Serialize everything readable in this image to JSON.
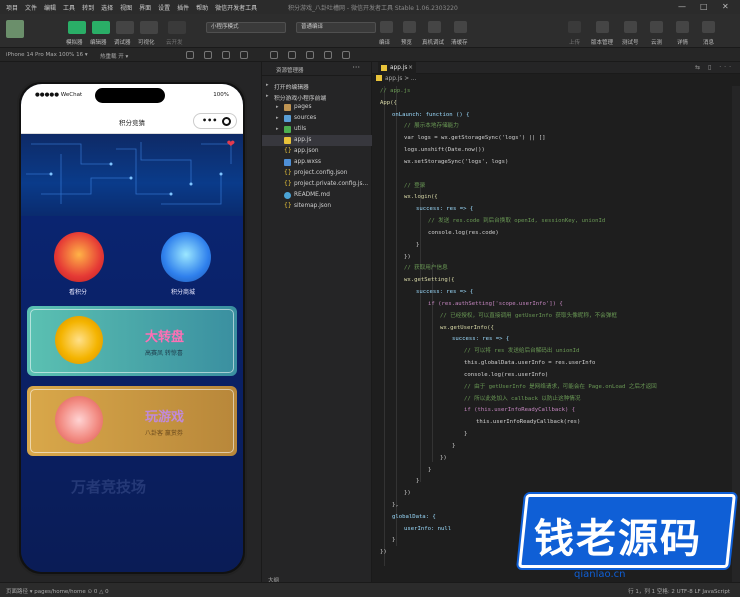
{
  "menu": {
    "items": [
      "项目",
      "文件",
      "编辑",
      "工具",
      "转到",
      "选择",
      "视图",
      "界面",
      "设置",
      "插件",
      "帮助",
      "微信开发者工具"
    ],
    "title": "积分游戏_八卦吐槽网 - 微信开发者工具 Stable 1.06.2303220"
  },
  "toolbar": {
    "buttons": [
      "模拟器",
      "编辑器",
      "调试器",
      "可视化",
      "云开发"
    ],
    "mode_select": "小程序模式",
    "compile_select": "普通编译",
    "mid_labels": [
      "编译",
      "预览",
      "真机调试",
      "清缓存"
    ],
    "right_labels": [
      "上传",
      "版本管理",
      "测试号",
      "云测",
      "详情",
      "消息"
    ]
  },
  "subbar": {
    "device": "iPhone 14 Pro Max 100% 16 ▾",
    "hotreload": "热重载 开 ▾"
  },
  "phone": {
    "carrier": "●●●●● WeChat",
    "battery": "100%",
    "nav_title": "积分竞猜",
    "entries": [
      {
        "label": "看积分"
      },
      {
        "label": "积分商城"
      }
    ],
    "cards": [
      {
        "title": "大转盘",
        "subtitle": "高赛凤 转惊喜"
      },
      {
        "title": "玩游戏",
        "subtitle": "八卦客 赢赏券"
      }
    ],
    "ghost_text": "万者竞技场"
  },
  "explorer": {
    "header": "资源管理器",
    "more": "···",
    "items": [
      {
        "label": "打开的编辑器",
        "type": "section",
        "indent": 0
      },
      {
        "label": "积分游戏小程序前端",
        "type": "section",
        "indent": 0
      },
      {
        "label": "pages",
        "type": "folder",
        "indent": 1
      },
      {
        "label": "sources",
        "type": "folder-blue",
        "indent": 1
      },
      {
        "label": "utils",
        "type": "folder-green",
        "indent": 1
      },
      {
        "label": "app.js",
        "type": "js",
        "indent": 1,
        "selected": true
      },
      {
        "label": "app.json",
        "type": "json",
        "indent": 1
      },
      {
        "label": "app.wxss",
        "type": "wxss",
        "indent": 1
      },
      {
        "label": "project.config.json",
        "type": "json",
        "indent": 1
      },
      {
        "label": "project.private.config.js...",
        "type": "json",
        "indent": 1
      },
      {
        "label": "README.md",
        "type": "md",
        "indent": 1
      },
      {
        "label": "sitemap.json",
        "type": "json",
        "indent": 1
      }
    ],
    "outline": "大纲"
  },
  "editor": {
    "tab": "app.js",
    "breadcrumb": "app.js > ...",
    "lines": [
      {
        "text": "// app.js",
        "c": "#6a9955",
        "i": 0
      },
      {
        "text": "App({",
        "c": "#dcdcaa",
        "i": 0
      },
      {
        "text": "onLaunch: function () {",
        "c": "#9cdcfe",
        "i": 1
      },
      {
        "text": "// 展示本地存储能力",
        "c": "#6a9955",
        "i": 2
      },
      {
        "text": "var logs = wx.getStorageSync('logs') || []",
        "c": "#d4d4d4",
        "i": 2
      },
      {
        "text": "logs.unshift(Date.now())",
        "c": "#d4d4d4",
        "i": 2
      },
      {
        "text": "wx.setStorageSync('logs', logs)",
        "c": "#d4d4d4",
        "i": 2
      },
      {
        "text": "",
        "c": "#d4d4d4",
        "i": 0
      },
      {
        "text": "// 登录",
        "c": "#6a9955",
        "i": 2
      },
      {
        "text": "wx.login({",
        "c": "#dcdcaa",
        "i": 2
      },
      {
        "text": "success: res => {",
        "c": "#9cdcfe",
        "i": 3
      },
      {
        "text": "// 发送 res.code 到后台换取 openId, sessionKey, unionId",
        "c": "#6a9955",
        "i": 4
      },
      {
        "text": "console.log(res.code)",
        "c": "#d4d4d4",
        "i": 4
      },
      {
        "text": "}",
        "c": "#d4d4d4",
        "i": 3
      },
      {
        "text": "})",
        "c": "#d4d4d4",
        "i": 2
      },
      {
        "text": "// 获取用户信息",
        "c": "#6a9955",
        "i": 2
      },
      {
        "text": "wx.getSetting({",
        "c": "#dcdcaa",
        "i": 2
      },
      {
        "text": "success: res => {",
        "c": "#9cdcfe",
        "i": 3
      },
      {
        "text": "if (res.authSetting['scope.userInfo']) {",
        "c": "#c586c0",
        "i": 4
      },
      {
        "text": "// 已经授权，可以直接调用 getUserInfo 获取头像昵称，不会弹框",
        "c": "#6a9955",
        "i": 5
      },
      {
        "text": "wx.getUserInfo({",
        "c": "#dcdcaa",
        "i": 5
      },
      {
        "text": "success: res => {",
        "c": "#9cdcfe",
        "i": 6
      },
      {
        "text": "// 可以将 res 发送给后台解码出 unionId",
        "c": "#6a9955",
        "i": 7
      },
      {
        "text": "this.globalData.userInfo = res.userInfo",
        "c": "#d4d4d4",
        "i": 7
      },
      {
        "text": "console.log(res.userInfo)",
        "c": "#d4d4d4",
        "i": 7
      },
      {
        "text": "// 由于 getUserInfo 是网络请求，可能会在 Page.onLoad 之后才返回",
        "c": "#6a9955",
        "i": 7
      },
      {
        "text": "// 所以此处加入 callback 以防止这种情况",
        "c": "#6a9955",
        "i": 7
      },
      {
        "text": "if (this.userInfoReadyCallback) {",
        "c": "#c586c0",
        "i": 7
      },
      {
        "text": "this.userInfoReadyCallback(res)",
        "c": "#d4d4d4",
        "i": 8
      },
      {
        "text": "}",
        "c": "#d4d4d4",
        "i": 7
      },
      {
        "text": "}",
        "c": "#d4d4d4",
        "i": 6
      },
      {
        "text": "})",
        "c": "#d4d4d4",
        "i": 5
      },
      {
        "text": "}",
        "c": "#d4d4d4",
        "i": 4
      },
      {
        "text": "}",
        "c": "#d4d4d4",
        "i": 3
      },
      {
        "text": "})",
        "c": "#d4d4d4",
        "i": 2
      },
      {
        "text": "},",
        "c": "#d4d4d4",
        "i": 1
      },
      {
        "text": "globalData: {",
        "c": "#9cdcfe",
        "i": 1
      },
      {
        "text": "userInfo: null",
        "c": "#9cdcfe",
        "i": 2
      },
      {
        "text": "}",
        "c": "#d4d4d4",
        "i": 1
      },
      {
        "text": "})",
        "c": "#d4d4d4",
        "i": 0
      }
    ]
  },
  "statusbar": {
    "left": "页面路径 ▾   pages/home/home   ⊙ 0 △ 0",
    "right": "行 1，列 1   空格: 2   UTF-8   LF   JavaScript"
  },
  "watermark": {
    "text": "钱老源码",
    "url": "qianlao.cn"
  },
  "colors": {
    "accent_green": "#2aae67",
    "watermark_blue": "#0f5fd6"
  }
}
